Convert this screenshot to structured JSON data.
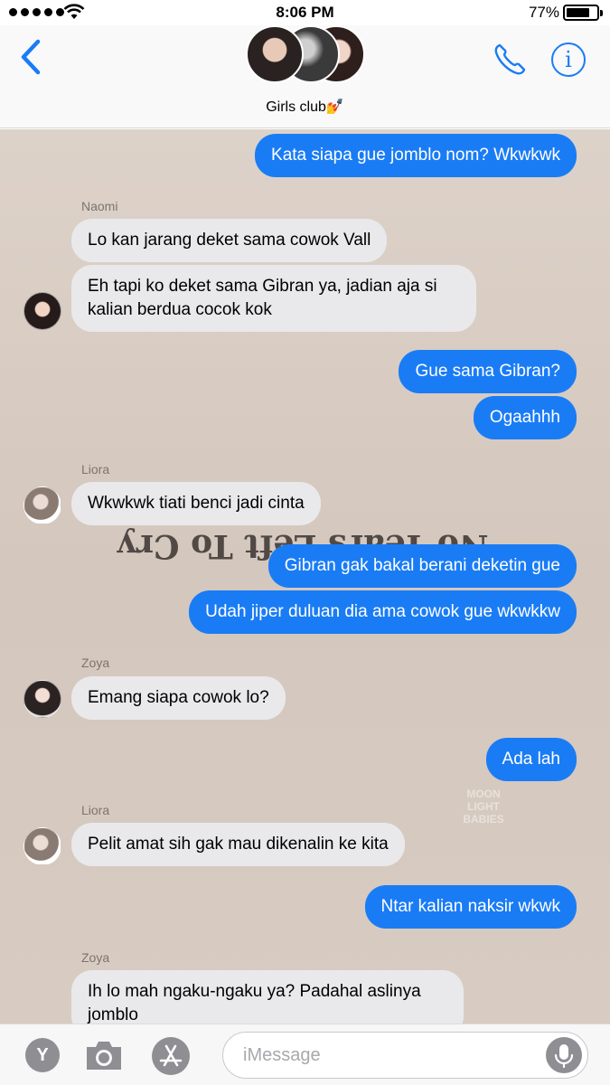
{
  "status_bar": {
    "time": "8:06 PM",
    "battery": "77%"
  },
  "header": {
    "group_name": "Girls club💅"
  },
  "chat": {
    "watermark": "No Tears Left To Cry",
    "watermark_small": "MOON LIGHT BABIES"
  },
  "messages": [
    {
      "type": "out",
      "text": "Kata siapa gue jomblo nom? Wkwkwk"
    },
    {
      "type": "in",
      "sender": "Naomi",
      "text": "Lo kan jarang deket sama cowok Vall"
    },
    {
      "type": "in",
      "text": "Eh tapi ko deket sama Gibran ya, jadian aja si kalian berdua cocok kok"
    },
    {
      "type": "out",
      "text": "Gue sama Gibran?"
    },
    {
      "type": "out",
      "text": "Ogaahhh"
    },
    {
      "type": "in",
      "sender": "Liora",
      "text": "Wkwkwk tiati benci jadi cinta"
    },
    {
      "type": "out",
      "text": "Gibran gak bakal berani deketin gue"
    },
    {
      "type": "out",
      "text": "Udah jiper duluan dia ama cowok gue wkwkkw"
    },
    {
      "type": "in",
      "sender": "Zoya",
      "text": "Emang siapa cowok lo?"
    },
    {
      "type": "out",
      "text": "Ada lah"
    },
    {
      "type": "in",
      "sender": "Liora",
      "text": "Pelit amat sih gak mau dikenalin ke kita"
    },
    {
      "type": "out",
      "text": "Ntar kalian naksir wkwk"
    },
    {
      "type": "in",
      "sender": "Zoya",
      "text": "Ih lo mah ngaku-ngaku ya? Padahal aslinya jomblo"
    }
  ],
  "input": {
    "placeholder": "iMessage",
    "y_label": "Y"
  },
  "icons": {
    "back": "chevron-left-icon",
    "phone": "phone-icon",
    "info": "info-icon",
    "camera": "camera-icon",
    "apps": "app-store-icon",
    "mic": "microphone-icon"
  },
  "colors": {
    "accent": "#1a7cf5",
    "incoming_bubble": "#e9e9eb"
  }
}
